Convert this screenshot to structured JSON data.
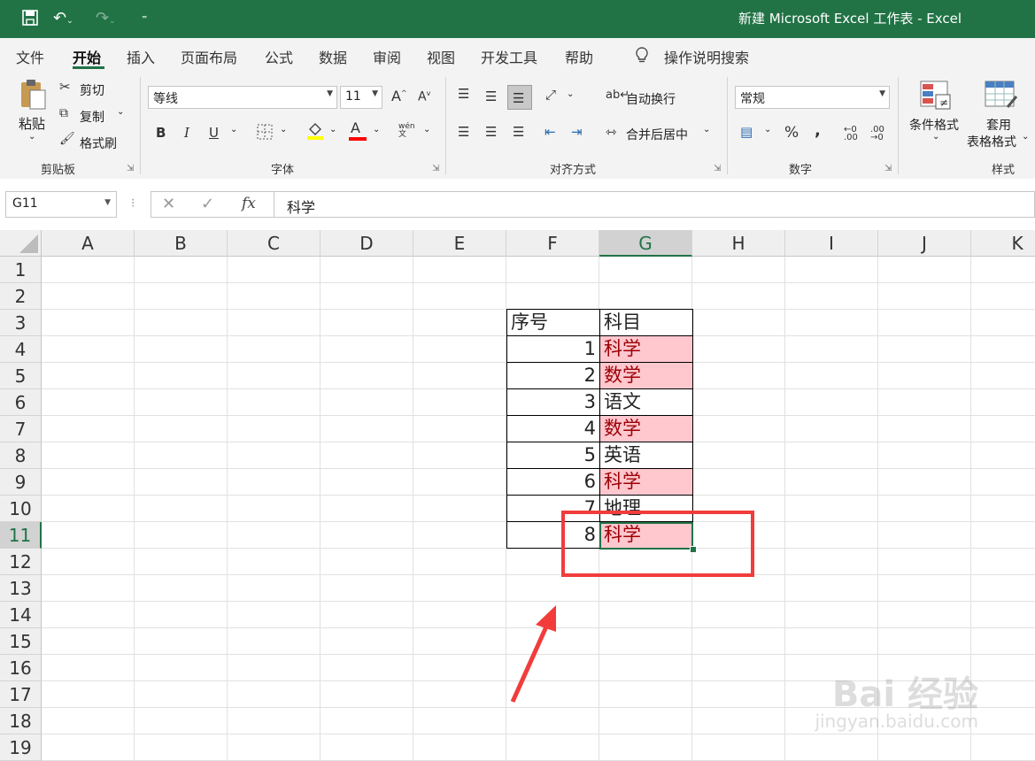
{
  "window": {
    "title": "新建 Microsoft Excel 工作表  -  Excel"
  },
  "menu_tabs": [
    "文件",
    "开始",
    "插入",
    "页面布局",
    "公式",
    "数据",
    "审阅",
    "视图",
    "开发工具",
    "帮助"
  ],
  "active_tab": "开始",
  "tell_me": "操作说明搜索",
  "ribbon": {
    "clipboard": {
      "paste": "粘贴",
      "cut": "剪切",
      "copy": "复制",
      "format_painter": "格式刷",
      "label": "剪贴板"
    },
    "font": {
      "name": "等线",
      "size": "11",
      "bold": "B",
      "italic": "I",
      "underline": "U",
      "increase": "A",
      "decrease": "A",
      "font_color_letter": "A",
      "phonetic": "wén",
      "label": "字体"
    },
    "alignment": {
      "wrap_text": "自动换行",
      "merge_center": "合并后居中",
      "label": "对齐方式"
    },
    "number": {
      "format": "常规",
      "percent": "%",
      "comma": ",",
      "inc_decimal": ".00",
      "dec_decimal": ".00",
      "label": "数字"
    },
    "styles": {
      "conditional_formatting": "条件格式",
      "format_as_table_1": "套用",
      "format_as_table_2": "表格格式",
      "label": "样式"
    }
  },
  "formula_bar": {
    "name_box": "G11",
    "fx": "fx",
    "content": "科学"
  },
  "columns": [
    "A",
    "B",
    "C",
    "D",
    "E",
    "F",
    "G",
    "H",
    "I",
    "J",
    "K"
  ],
  "rows": [
    "1",
    "2",
    "3",
    "4",
    "5",
    "6",
    "7",
    "8",
    "9",
    "10",
    "11",
    "12",
    "13",
    "14",
    "15",
    "16",
    "17",
    "18",
    "19"
  ],
  "selected_cell": {
    "column": "G",
    "row": "11"
  },
  "table": {
    "headers": [
      "序号",
      "科目"
    ],
    "rows": [
      {
        "num": "1",
        "subject": "科学",
        "highlight": true
      },
      {
        "num": "2",
        "subject": "数学",
        "highlight": true
      },
      {
        "num": "3",
        "subject": "语文",
        "highlight": false
      },
      {
        "num": "4",
        "subject": "数学",
        "highlight": true
      },
      {
        "num": "5",
        "subject": "英语",
        "highlight": false
      },
      {
        "num": "6",
        "subject": "科学",
        "highlight": true
      },
      {
        "num": "7",
        "subject": "地理",
        "highlight": false
      },
      {
        "num": "8",
        "subject": "科学",
        "highlight": true
      }
    ]
  },
  "watermark": {
    "brand": "Bai 经验",
    "url": "jingyan.baidu.com"
  },
  "colors": {
    "excel_green": "#217346",
    "highlight_fill": "#ffc7ce",
    "highlight_text": "#9c0006",
    "annotation_red": "#f23c3c"
  }
}
